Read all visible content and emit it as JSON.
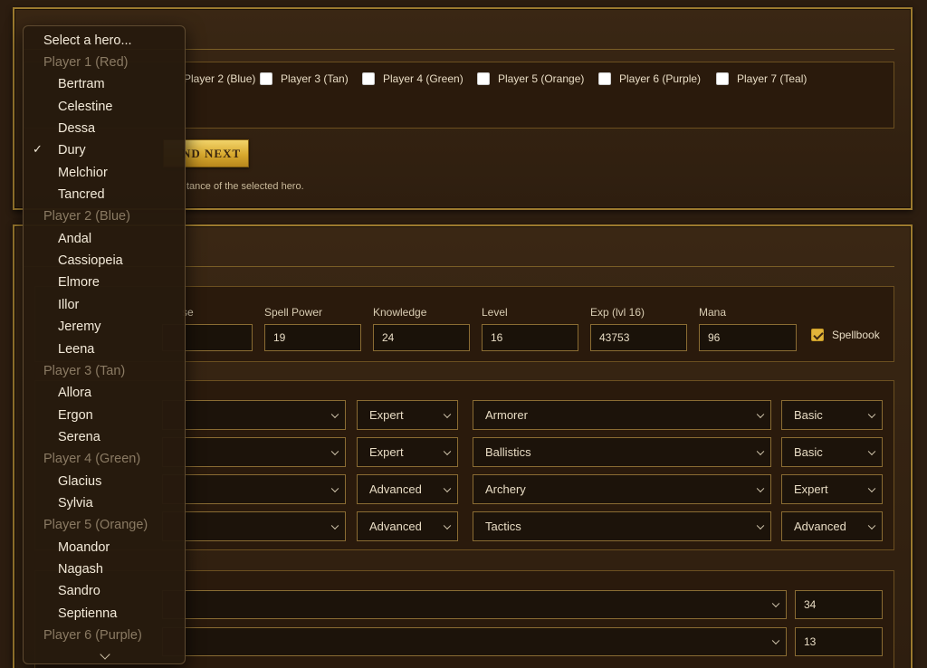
{
  "players": {
    "options": [
      {
        "label": "Player 2 (Blue)",
        "checked": false
      },
      {
        "label": "Player 3 (Tan)",
        "checked": false
      },
      {
        "label": "Player 4 (Green)",
        "checked": false
      },
      {
        "label": "Player 5 (Orange)",
        "checked": false
      },
      {
        "label": "Player 6 (Purple)",
        "checked": false
      },
      {
        "label": "Player 7 (Teal)",
        "checked": false
      }
    ]
  },
  "actions": {
    "next_button_label": "ND NEXT",
    "hint": "tance of the selected hero."
  },
  "stats": {
    "partial_label": "se",
    "spell_power_label": "Spell Power",
    "spell_power": "19",
    "knowledge_label": "Knowledge",
    "knowledge": "24",
    "level_label": "Level",
    "level": "16",
    "exp_label": "Exp (lvl 16)",
    "exp": "43753",
    "mana_label": "Mana",
    "mana": "96",
    "spellbook_label": "Spellbook",
    "spellbook_checked": true
  },
  "skills": {
    "rows": [
      {
        "level_a": "Expert",
        "skill_b": "Armorer",
        "level_b": "Basic"
      },
      {
        "level_a": "Expert",
        "skill_b": "Ballistics",
        "level_b": "Basic"
      },
      {
        "level_a": "Advanced",
        "skill_b": "Archery",
        "level_b": "Expert"
      },
      {
        "level_a": "Advanced",
        "skill_b": "Tactics",
        "level_b": "Advanced"
      }
    ]
  },
  "army": {
    "rows": [
      {
        "count": "34"
      },
      {
        "count": "13"
      }
    ]
  },
  "hero_dropdown": {
    "prompt": "Select a hero...",
    "selected": "Dury",
    "groups": [
      {
        "header": "Player 1 (Red)",
        "heroes": [
          "Bertram",
          "Celestine",
          "Dessa",
          "Dury",
          "Melchior",
          "Tancred"
        ]
      },
      {
        "header": "Player 2 (Blue)",
        "heroes": [
          "Andal",
          "Cassiopeia",
          "Elmore",
          "Illor",
          "Jeremy",
          "Leena"
        ]
      },
      {
        "header": "Player 3 (Tan)",
        "heroes": [
          "Allora",
          "Ergon",
          "Serena"
        ]
      },
      {
        "header": "Player 4 (Green)",
        "heroes": [
          "Glacius",
          "Sylvia"
        ]
      },
      {
        "header": "Player 5 (Orange)",
        "heroes": [
          "Moandor",
          "Nagash",
          "Sandro",
          "Septienna"
        ]
      },
      {
        "header": "Player 6 (Purple)",
        "heroes": []
      }
    ]
  }
}
